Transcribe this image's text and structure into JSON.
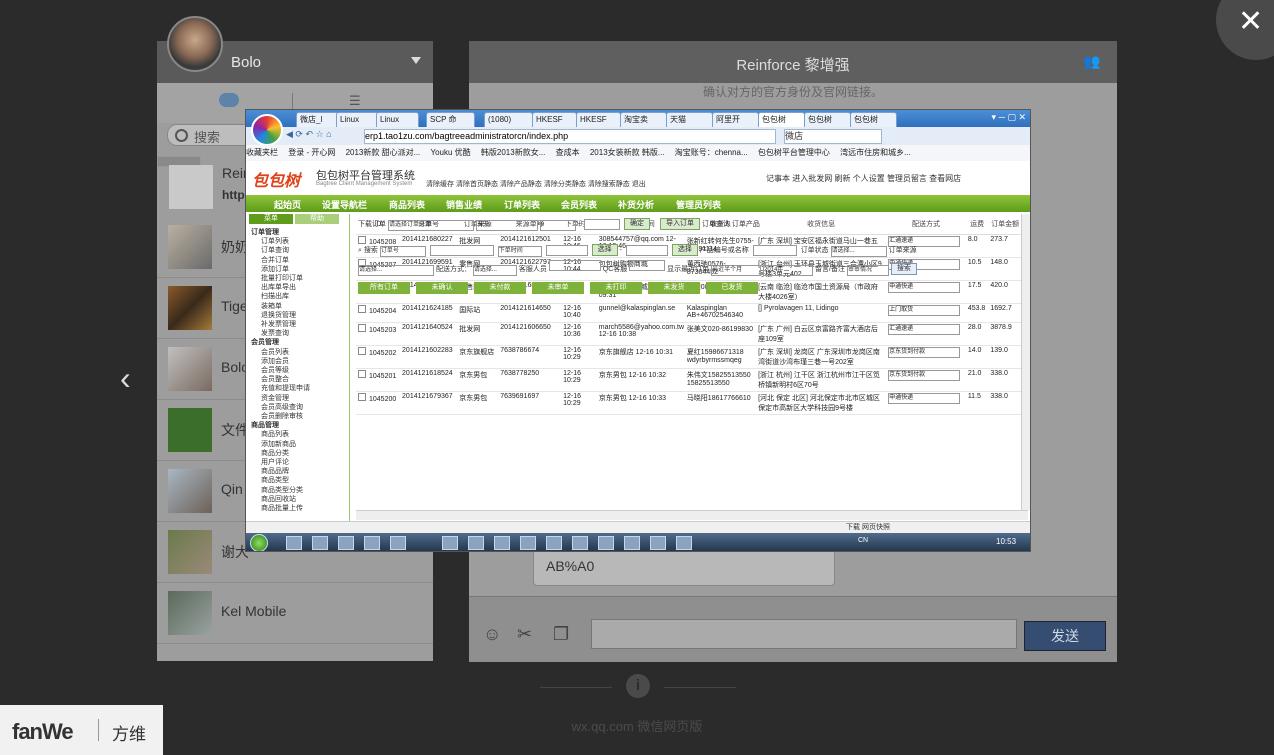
{
  "sidebar": {
    "user_name": "Bolo",
    "search_placeholder": "搜索",
    "contacts": [
      {
        "label": "Reinforce 黎增强",
        "sub": "http"
      },
      {
        "label": "奶奶"
      },
      {
        "label": "Tiger"
      },
      {
        "label": "Bolo"
      },
      {
        "label": "文件传输助手"
      },
      {
        "label": "Qin"
      },
      {
        "label": "谢大"
      },
      {
        "label": "Kel Mobile"
      }
    ]
  },
  "chat": {
    "title": "Reinforce 黎增强",
    "subtitle": "确认对方的官方身份及官网链接。",
    "bubble_text": "AB%A0",
    "send_label": "发送"
  },
  "footer": {
    "url": "wx.qq.com  微信网页版",
    "brand_en": "fanWe",
    "brand_cn": "方维"
  },
  "screenshot": {
    "tabs": [
      "微店_l",
      "Linux",
      "Linux",
      "SCP 命",
      "(1080)",
      "HKESF",
      "HKESF",
      "淘宝卖",
      "天猫",
      "阿里开",
      "包包树",
      "包包树",
      "包包树"
    ],
    "url": "erp1.tao1zu.com/bagtreeadministratorcn/index.php",
    "search_engine": "微店",
    "bookmarks": [
      "收藏夹栏",
      "登录 - 开心网",
      "2013新款 甜心派对...",
      "Youku 优酷",
      "韩版2013新款女...",
      "查成本",
      "2013女装新款 韩版...",
      "淘宝账号：chenna...",
      "包包树平台管理中心",
      "湾远市住房和城乡..."
    ],
    "app_title": "包包树",
    "app_name": "包包树平台管理系统",
    "app_name_en": "Bagtree Client Management System",
    "header_actions": [
      "清除缓存",
      "清除首页静态",
      "清除产品静态",
      "清除分类静态",
      "清除搜索静态",
      "退出"
    ],
    "header_right": [
      "记事本",
      "进入批发网",
      "刷新",
      "个人设置",
      "管理员留言",
      "查看网店"
    ],
    "menu": [
      "起始页",
      "设置导航栏",
      "商品列表",
      "销售业绩",
      "订单列表",
      "会员列表",
      "补货分析",
      "管理员列表"
    ],
    "left_tabs": [
      "菜单",
      "帮助"
    ],
    "tree": [
      {
        "g": "订单管理"
      },
      {
        "i": "订单列表"
      },
      {
        "i": "订单查询"
      },
      {
        "i": "合并订单"
      },
      {
        "i": "添加订单"
      },
      {
        "i": "批量打印订单"
      },
      {
        "i": "出库单导出"
      },
      {
        "i": "扫描出库"
      },
      {
        "i": "装箱单"
      },
      {
        "i": "退换货管理"
      },
      {
        "i": "补发票管理"
      },
      {
        "i": "发票查询"
      },
      {
        "g": "会员管理"
      },
      {
        "i": "会员列表"
      },
      {
        "i": "添加会员"
      },
      {
        "i": "会员等级"
      },
      {
        "i": "会员整合"
      },
      {
        "i": "充值和提现申请"
      },
      {
        "i": "资金管理"
      },
      {
        "i": "会员高级查询"
      },
      {
        "i": "会员删除审核"
      },
      {
        "g": "商品管理"
      },
      {
        "i": "商品列表"
      },
      {
        "i": "添加新商品"
      },
      {
        "i": "商品分类"
      },
      {
        "i": "用户评论"
      },
      {
        "i": "商品品牌"
      },
      {
        "i": "商品类型"
      },
      {
        "i": "商品类型分类"
      },
      {
        "i": "商品回收站"
      },
      {
        "i": "商品批量上传"
      }
    ],
    "filter1": {
      "label": "下载订单",
      "source": "请选择订单来源",
      "range": "当天",
      "num": "9",
      "confirm": "确定",
      "import": "导入订单",
      "links": "订单查询  订单产品"
    },
    "filter2": {
      "search": "搜索",
      "order_no": "订单号",
      "time": "下单时间",
      "select_btn": "选择",
      "select_btn2": "选择",
      "product_code": "产品编号或名称",
      "status_label": "订单状态",
      "status": "请选择...",
      "source_label": "订单来源"
    },
    "filter3": {
      "choose": "请选择...",
      "delivery": "配送方式：",
      "delivery_val": "请选择...",
      "service": "客服人员",
      "qc": "QC客服",
      "recent": "显示最近订单",
      "recent_val": "最近半个月",
      "year": "2014年",
      "remark": "留言/备注",
      "audit": "审审情况",
      "search_btn": "搜索"
    },
    "status_buttons": [
      "所有订单",
      "未确认",
      "未付款",
      "未审单",
      "未打印",
      "未发货",
      "已发货"
    ],
    "columns": [
      "ID",
      "订单号",
      "订单来源",
      "来源单号",
      "下单时间",
      "付款时间",
      "收货人",
      "收货信息",
      "配送方式",
      "运费",
      "订单金额"
    ],
    "rows": [
      {
        "id": "1045208",
        "no": "2014121680227",
        "src": "批发网",
        "src_no": "2014121612501",
        "t": "12-16 10:46",
        "pay": "308544757@qq.com 12-16 10:46",
        "name": "张新红转何先生0755-27491114",
        "addr": "[广东 深圳] 宝安区福永街道马山一巷五栋一楼商铺",
        "ship": "汇通速递",
        "fee": "8.0",
        "amt": "273.7"
      },
      {
        "id": "1045207",
        "no": "2014121699591",
        "src": "零售网",
        "src_no": "2014121622797",
        "t": "12-16 10:44",
        "pay": "包包树购物商城",
        "name": "董西驰0576-87304452",
        "addr": "[浙江 台州] 玉环县玉城街道三合潭小区9号楼3单元402",
        "ship": "申通快递",
        "fee": "10.5",
        "amt": "148.0"
      },
      {
        "id": "1045206",
        "no": "2014121686935",
        "src": "零售网",
        "src_no": "2014121680743 2014121680573",
        "t": "12-16 10:43",
        "pay": "包包树购物商城 12-16 09:31",
        "name": "李娌0883-2123938",
        "addr": "[云南 临沧] 临沧市国土资源局（市政府大楼4026室）",
        "ship": "申通快递",
        "fee": "17.5",
        "amt": "420.0"
      },
      {
        "id": "1045204",
        "no": "2014121624185",
        "src": "国际站",
        "src_no": "2014121614650",
        "t": "12-16 10:40",
        "pay": "gunnel@kalaspinglan.se",
        "name": "Kalaspinglan AB+46702546340",
        "addr": "[] Pyrolavagen 11, Lidingo",
        "ship": "上门取货",
        "fee": "453.8",
        "amt": "1692.7"
      },
      {
        "id": "1045203",
        "no": "2014121640524",
        "src": "批发网",
        "src_no": "2014121606650",
        "t": "12-16 10:36",
        "pay": "march5586@yahoo.com.tw 12-16 10:38",
        "name": "张美文020-86199830",
        "addr": "[广东 广州] 白云区京富路齐富大酒店后座109室",
        "ship": "汇通速递",
        "fee": "28.0",
        "amt": "3878.9"
      },
      {
        "id": "1045202",
        "no": "2014121602283",
        "src": "京东旗舰店",
        "src_no": "7638786674",
        "t": "12-16 10:29",
        "pay": "京东旗舰店 12-16 10:31",
        "name": "夏红15986671318 wdyrbyrmssmqeg",
        "addr": "[广东 深圳] 龙岗区 广东深圳市龙岗区南湾街道沙湾布瑾三巷一号202室",
        "ship": "京东货到付款",
        "fee": "14.0",
        "amt": "139.0"
      },
      {
        "id": "1045201",
        "no": "2014121618524",
        "src": "京东男包",
        "src_no": "7638778250",
        "t": "12-16 10:29",
        "pay": "京东男包 12-16 10:32",
        "name": "朱伟文15825513550 15825513550",
        "addr": "[浙江 杭州] 江干区 浙江杭州市江干区笕桥镇新明村6区70号",
        "ship": "京东货到付款",
        "fee": "21.0",
        "amt": "338.0"
      },
      {
        "id": "1045200",
        "no": "2014121679367",
        "src": "京东男包",
        "src_no": "7639691697",
        "t": "12-16 10:29",
        "pay": "京东男包 12-16 10:33",
        "name": "马晓阳18617766610",
        "addr": "[河北 保定 北区] 河北保定市北市区城区保定市高新区大学科技园9号楼",
        "ship": "申通快递",
        "fee": "11.5",
        "amt": "338.0"
      }
    ],
    "status_right": "下载  网页快照",
    "clock": "10:53",
    "ime": "CN"
  }
}
